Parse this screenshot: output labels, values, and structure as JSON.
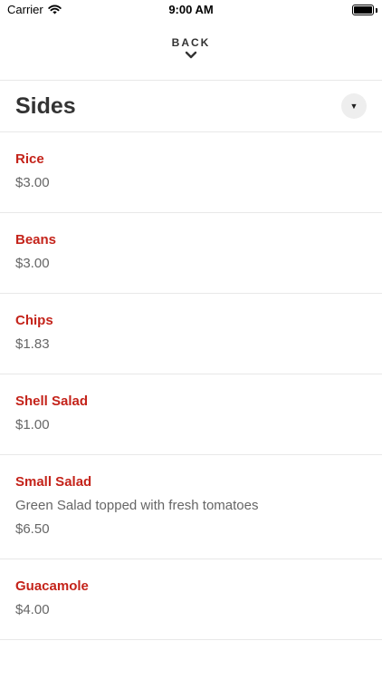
{
  "status_bar": {
    "carrier": "Carrier",
    "time": "9:00 AM",
    "battery_level": 1.0
  },
  "nav": {
    "back_label": "BACK",
    "back_icon": "chevron-down-icon"
  },
  "section": {
    "title": "Sides",
    "dropdown_icon": "triangle-down-icon"
  },
  "colors": {
    "item_name": "#c4231a",
    "secondary_text": "#666666",
    "divider": "#e8e8e8"
  },
  "items": [
    {
      "name": "Rice",
      "description": "",
      "price": "$3.00"
    },
    {
      "name": "Beans",
      "description": "",
      "price": "$3.00"
    },
    {
      "name": "Chips",
      "description": "",
      "price": "$1.83"
    },
    {
      "name": "Shell Salad",
      "description": "",
      "price": "$1.00"
    },
    {
      "name": "Small Salad",
      "description": "Green Salad topped with fresh tomatoes",
      "price": "$6.50"
    },
    {
      "name": "Guacamole",
      "description": "",
      "price": "$4.00"
    }
  ]
}
